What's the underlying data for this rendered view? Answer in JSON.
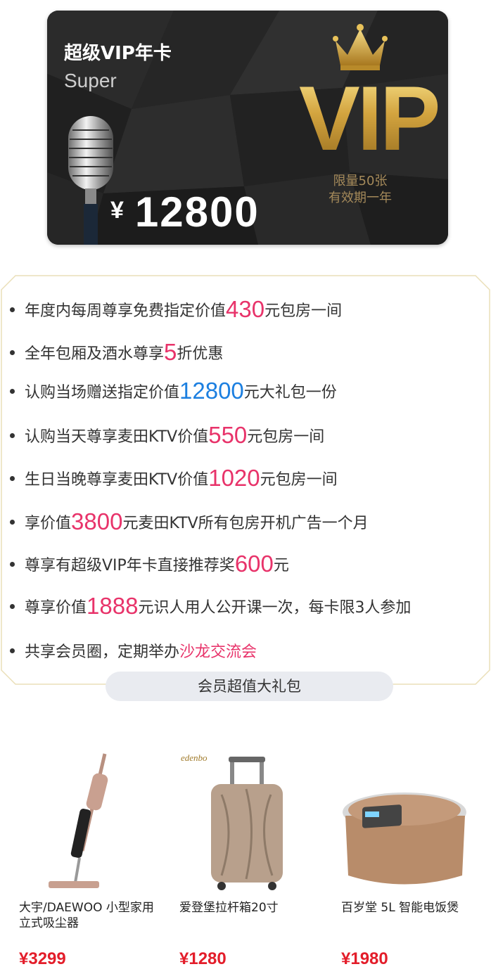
{
  "card": {
    "title": "超级VIP年卡",
    "subtitle": "Super",
    "currency": "¥",
    "price": "12800",
    "vip_text": "VIP",
    "note_line1": "限量50张",
    "note_line2": "有效期一年"
  },
  "benefits": [
    {
      "pre": "年度内每周尊享免费指定价值",
      "hl": "430",
      "post": "元包房一间"
    },
    {
      "pre": "全年包厢及酒水尊享",
      "hl": "5",
      "post": "折优惠"
    },
    {
      "pre": "认购当场赠送指定价值",
      "hl": "12800",
      "post": "元大礼包一份"
    },
    {
      "pre": "认购当天尊享麦田KTV价值",
      "hl": "550",
      "post": "元包房一间"
    },
    {
      "pre": "生日当晚尊享麦田KTV价值",
      "hl": "1020",
      "post": "元包房一间"
    },
    {
      "pre": "享价值",
      "hl": "3800",
      "post": "元麦田KTV所有包房开机广告一个月"
    },
    {
      "pre": "尊享有超级VIP年卡直接推荐奖",
      "hl": "600",
      "post": "元"
    },
    {
      "pre": "尊享价值",
      "hl": "1888",
      "post": "元识人用人公开课一次，每卡限3人参加"
    },
    {
      "pre": "共享会员圈，定期举办",
      "hl": "沙龙交流会",
      "post": ""
    }
  ],
  "gift_section_title": "会员超值大礼包",
  "products": [
    {
      "name": "大宇/DAEWOO 小型家用立式吸尘器",
      "price": "¥3299",
      "icon": "vacuum-cleaner"
    },
    {
      "name": "爱登堡拉杆箱20寸",
      "price": "¥1280",
      "icon": "suitcase",
      "brand": "edenbo"
    },
    {
      "name": "百岁堂 5L 智能电饭煲",
      "price": "¥1980",
      "icon": "rice-cooker"
    }
  ],
  "colors": {
    "accent_pink": "#e8336a",
    "accent_blue": "#1c7fe0",
    "price_red": "#e31d2a",
    "gold": "#c9a038"
  }
}
